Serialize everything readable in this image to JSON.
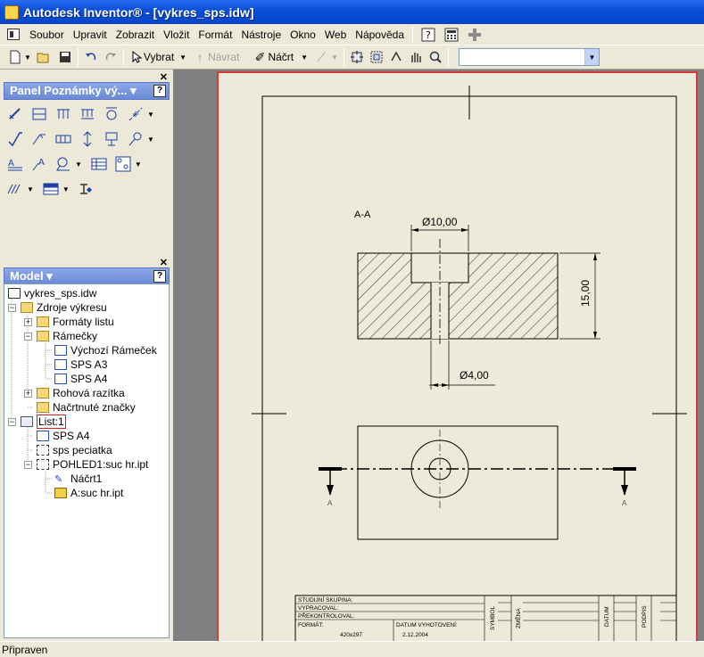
{
  "window": {
    "title": "Autodesk Inventor® - [vykres_sps.idw]"
  },
  "menu": {
    "items": [
      {
        "label": "Soubor"
      },
      {
        "label": "Upravit"
      },
      {
        "label": "Zobrazit"
      },
      {
        "label": "Vložit"
      },
      {
        "label": "Formát"
      },
      {
        "label": "Nástroje"
      },
      {
        "label": "Okno"
      },
      {
        "label": "Web"
      },
      {
        "label": "Nápověda"
      }
    ]
  },
  "toolbar": {
    "select_label": "Vybrat",
    "return_label": "Návrat",
    "sketch_label": "Náčrt",
    "combo_value": ""
  },
  "panel": {
    "title": "Panel Poznámky vý... ▾",
    "help_glyph": "?"
  },
  "model": {
    "title": "Model ▾",
    "help_glyph": "?",
    "tree": [
      {
        "label": "vykres_sps.idw"
      },
      {
        "label": "Zdroje výkresu"
      },
      {
        "label": "Formáty listu"
      },
      {
        "label": "Rámečky"
      },
      {
        "label": "Výchozí Rámeček"
      },
      {
        "label": "SPS A3"
      },
      {
        "label": "SPS A4"
      },
      {
        "label": "Rohová razítka"
      },
      {
        "label": "Načrtnuté značky"
      },
      {
        "label": "List:1"
      },
      {
        "label": "SPS A4"
      },
      {
        "label": "sps peciatka"
      },
      {
        "label": "POHLED1:suc hr.ipt"
      },
      {
        "label": "Náčrt1"
      },
      {
        "label": "A:suc hr.ipt"
      }
    ]
  },
  "drawing": {
    "section_label": "A-A",
    "dim_top": "Ø10,00",
    "dim_height": "15,00",
    "dim_small": "Ø4,00",
    "section_mark_left": "A",
    "section_mark_right": "A",
    "titleblock": {
      "row1": "STUDIJNÍ SKUPINA:",
      "row2": "VYPRACOVAL:",
      "row3": "PŘEKONTROLOVAL:",
      "row4": "FORMÁT:",
      "format_value": "420x297",
      "date_label": "DATUM VYHOTOVENÍ:",
      "date_value": "2.12.2004",
      "symbol": "SYMBOL",
      "zmena": "ZMĚNA",
      "datum": "DATUM",
      "podpis": "PODPIS"
    }
  },
  "status": {
    "text": "Připraven"
  },
  "colors": {
    "titlebar": "#0a4fd8",
    "sheet": "#ecead9",
    "border_red": "#d83a3a"
  }
}
